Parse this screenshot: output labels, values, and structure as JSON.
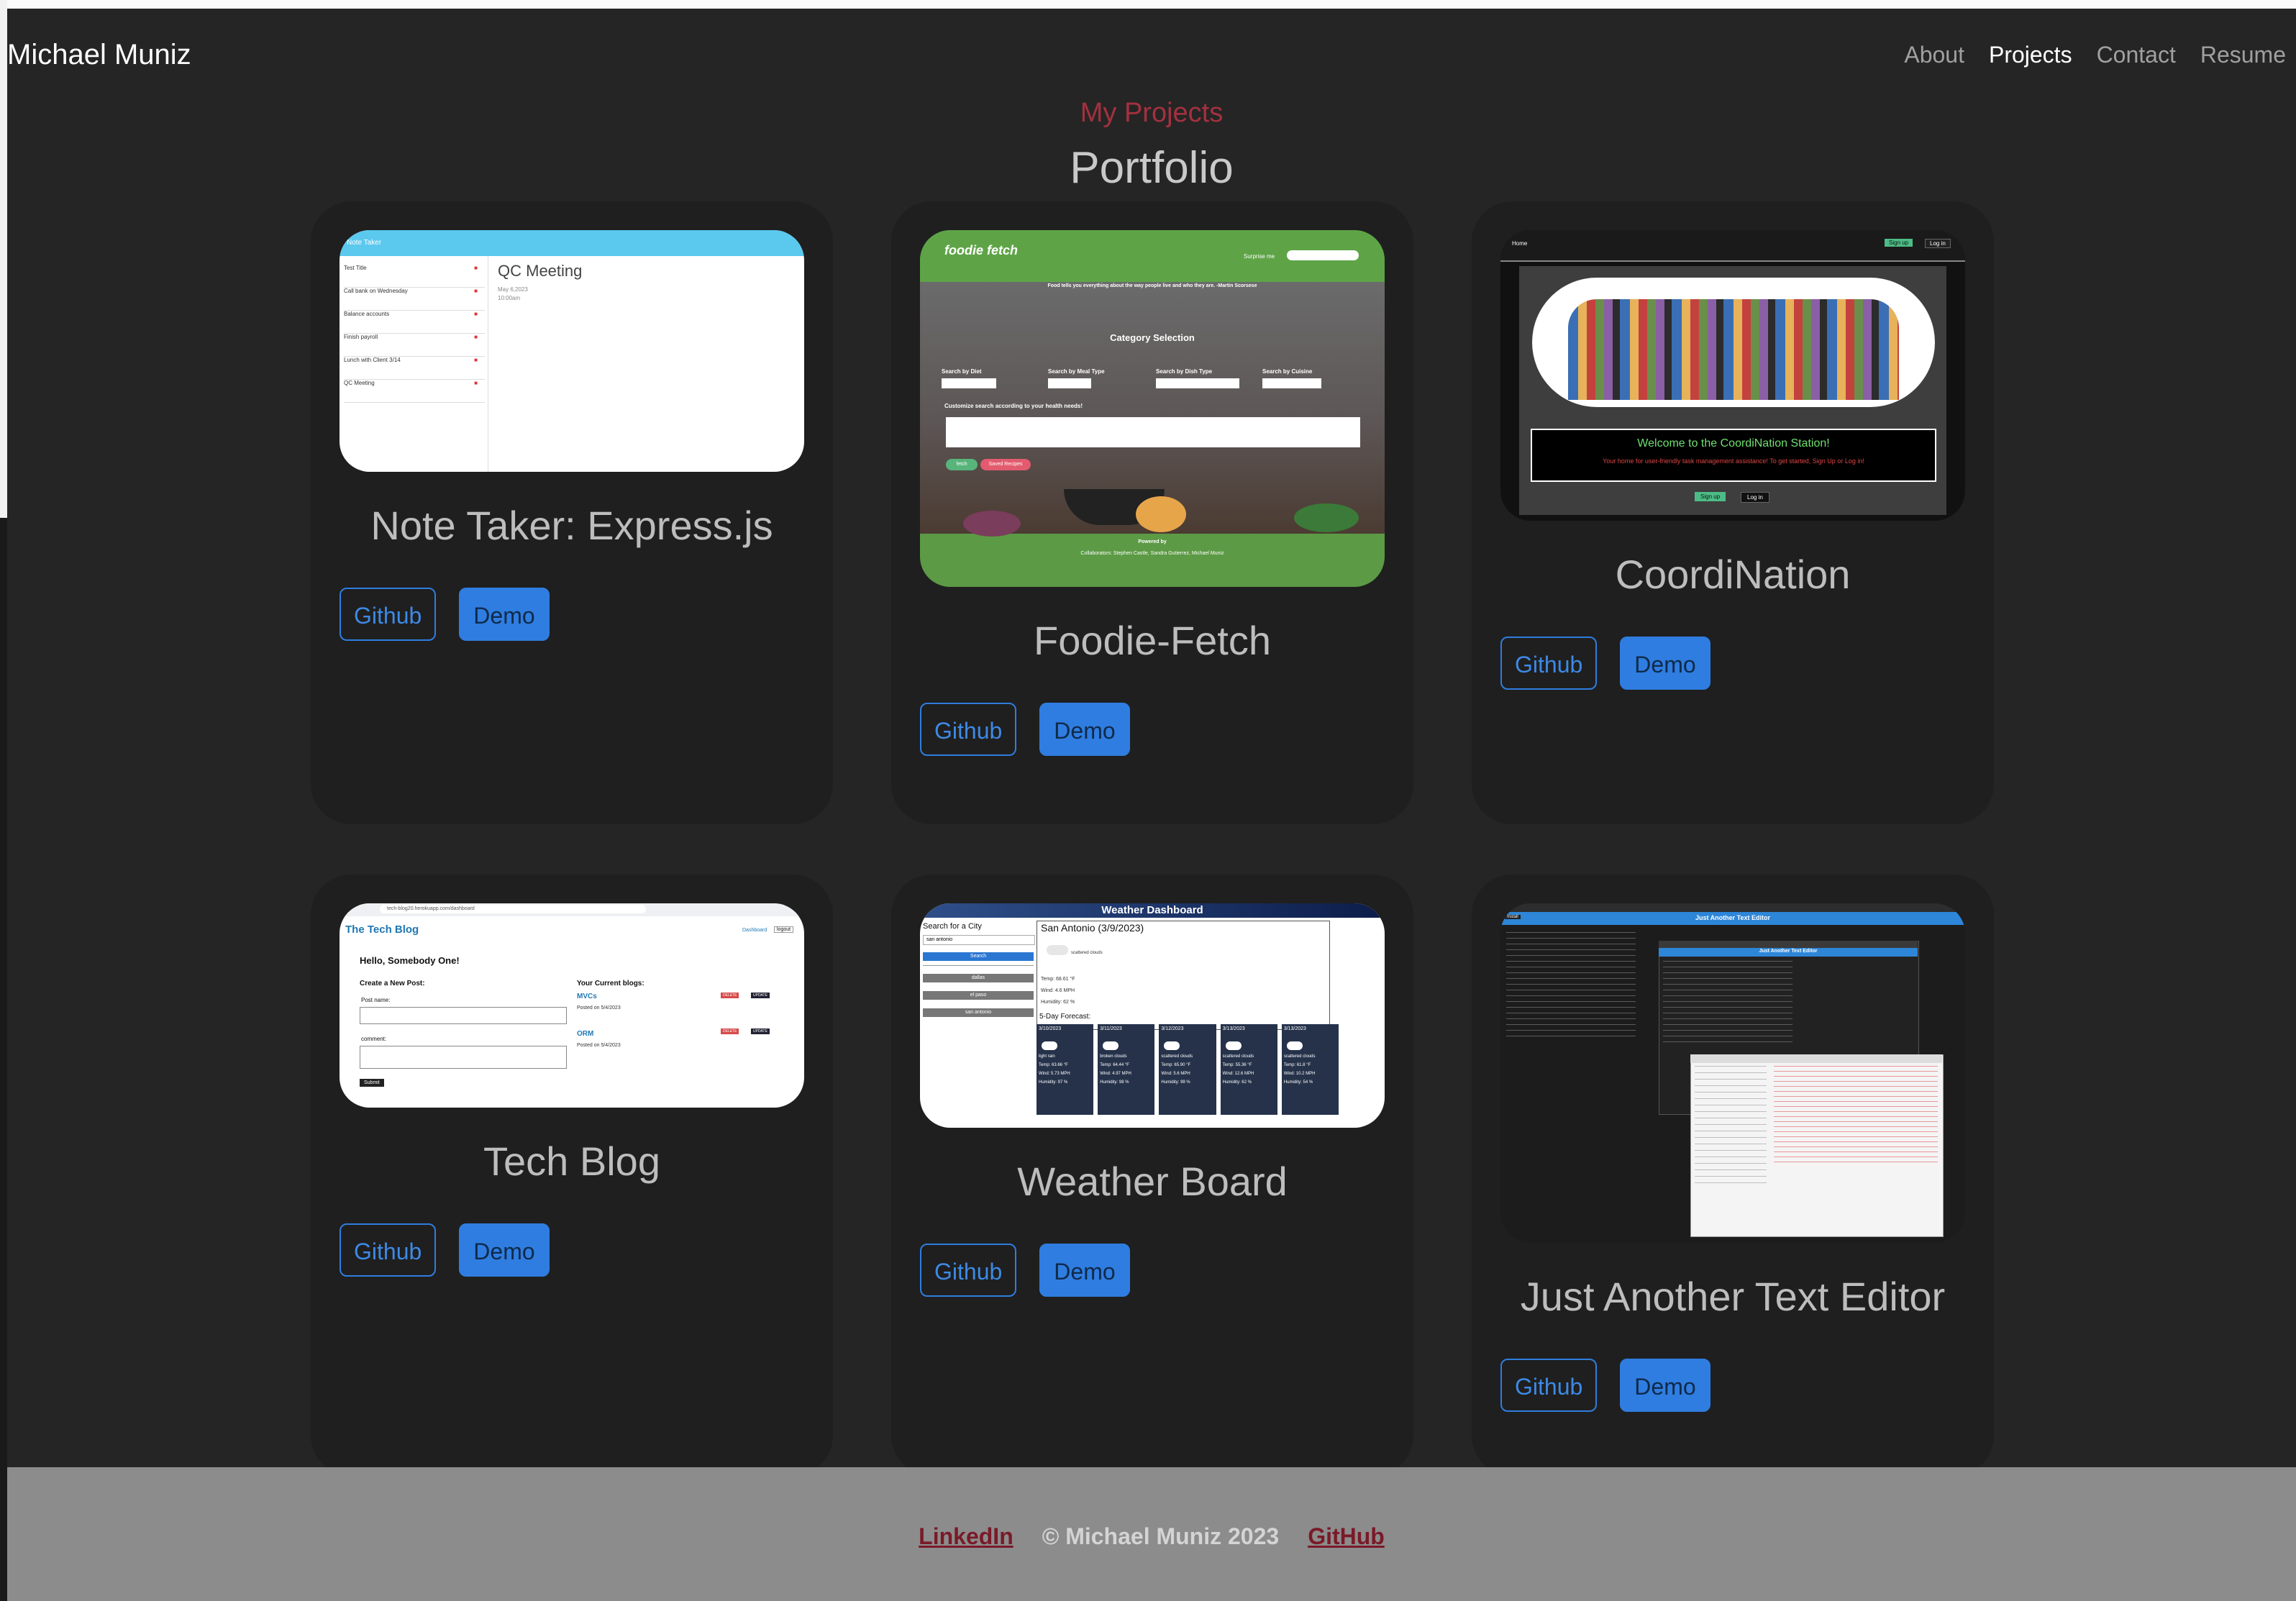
{
  "navbar": {
    "brand": "Michael Muniz",
    "links": [
      "About",
      "Projects",
      "Contact",
      "Resume"
    ],
    "active": "Projects"
  },
  "header": {
    "subtitle": "My Projects",
    "title": "Portfolio"
  },
  "projects": [
    {
      "title": "Note Taker: Express.js",
      "github_label": "Github",
      "demo_label": "Demo",
      "thumb": {
        "app_name": "Note Taker",
        "heading": "QC Meeting",
        "date": "May 6,2023",
        "time": "10:00am",
        "notes": [
          "Test Title",
          "Call bank on Wednesday",
          "Balance accounts",
          "Finish payroll",
          "Lunch with Client 3/14",
          "QC Meeting"
        ]
      }
    },
    {
      "title": "Foodie-Fetch",
      "github_label": "Github",
      "demo_label": "Demo",
      "thumb": {
        "logo": "foodie fetch",
        "surprise": "Surprise me",
        "tagline": "Food tells you everything about the way people live and who they are. -Martin Scorsese",
        "section": "Category Selection",
        "filters": [
          "Search by Diet",
          "Search by Meal Type",
          "Search by Dish Type",
          "Search by Cuisine"
        ],
        "filter_value": "None",
        "customize": "Customize search according to your health needs!",
        "fetch_btn": "fetch",
        "saved_btn": "Saved Recipes",
        "credits": "Powered by",
        "collab": "Collaborators: Stephen Castle, Sandra Gutierrez, Michael Muniz"
      }
    },
    {
      "title": "CoordiNation",
      "github_label": "Github",
      "demo_label": "Demo",
      "thumb": {
        "home": "Home",
        "signup": "Sign up",
        "login": "Log in",
        "welcome": "Welcome to the CoordiNation Station!",
        "welcome_sub": "Your home for user-friendly task management assistance! To get started, Sign Up or Log in!"
      }
    },
    {
      "title": "Tech Blog",
      "github_label": "Github",
      "demo_label": "Demo",
      "thumb": {
        "url": "tech-blog20.herokuapp.com/dashboard",
        "site": "The Tech Blog",
        "dash": "Dashboard",
        "logout": "logout",
        "hello": "Hello, Somebody One!",
        "create": "Create a New Post:",
        "post_name": "Post name:",
        "comment": "comment:",
        "submit": "Submit",
        "current": "Your Current blogs:",
        "blogs": [
          {
            "name": "MVCs",
            "date": "Posted on 5/4/2023"
          },
          {
            "name": "ORM",
            "date": "Posted on 5/4/2023"
          }
        ],
        "delete": "DELETE",
        "update": "UPDATE"
      }
    },
    {
      "title": "Weather Board",
      "github_label": "Github",
      "demo_label": "Demo",
      "thumb": {
        "header": "Weather Dashboard",
        "search_label": "Search for a City",
        "search_value": "san antonio",
        "search_btn": "Search",
        "history": [
          "dallas",
          "el paso",
          "san antonio"
        ],
        "city": "San Antonio (3/9/2023)",
        "conditions": "scattered clouds",
        "temp": "Temp: 68.61 °F",
        "wind": "Wind: 4.6 MPH",
        "humidity": "Humidity: 62 %",
        "forecast_label": "5-Day Forecast:",
        "forecast": [
          {
            "date": "3/10/2023",
            "desc": "light rain",
            "temp": "Temp: 63.66 °F",
            "wind": "Wind: 5.73 MPH",
            "hum": "Humidity: 97 %"
          },
          {
            "date": "3/11/2023",
            "desc": "broken clouds",
            "temp": "Temp: 64.44 °F",
            "wind": "Wind: 4.97 MPH",
            "hum": "Humidity: 98 %"
          },
          {
            "date": "3/12/2023",
            "desc": "scattered clouds",
            "temp": "Temp: 65.90 °F",
            "wind": "Wind: 5.6 MPH",
            "hum": "Humidity: 99 %"
          },
          {
            "date": "3/13/2023",
            "desc": "scattered clouds",
            "temp": "Temp: 55.36 °F",
            "wind": "Wind: 12.6 MPH",
            "hum": "Humidity: 62 %"
          },
          {
            "date": "3/13/2023",
            "desc": "scattered clouds",
            "temp": "Temp: 61.8 °F",
            "wind": "Wind: 10.2 MPH",
            "hum": "Humidity: 54 %"
          }
        ]
      }
    },
    {
      "title": "Just Another Text Editor",
      "github_label": "Github",
      "demo_label": "Demo",
      "thumb": {
        "app_name": "Just Another Text Editor",
        "install": "Install"
      }
    }
  ],
  "footer": {
    "linkedin": "LinkedIn",
    "copyright": "© Michael Muniz 2023",
    "github": "GitHub"
  },
  "colors": {
    "background": "#252525",
    "card": "#1f1f1f",
    "accent_red": "#a3313f",
    "button_blue": "#2f7de0",
    "footer": "#8c8c8c"
  }
}
